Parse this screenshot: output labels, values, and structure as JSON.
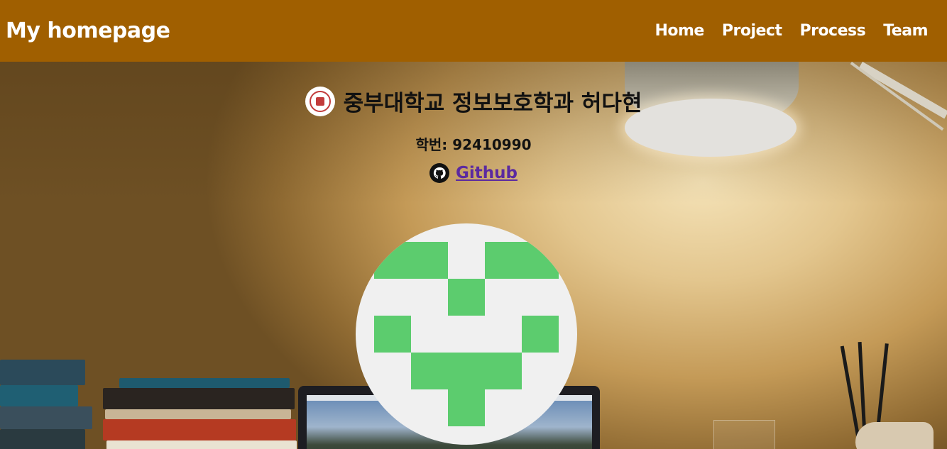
{
  "nav": {
    "brand": "My homepage",
    "links": [
      "Home",
      "Project",
      "Process",
      "Team"
    ]
  },
  "profile": {
    "title": "중부대학교 정보보호학과 허다현",
    "student_id": "학번: 92410990",
    "github_label": "Github"
  },
  "colors": {
    "navbar": "#a05f00",
    "identicon": "#5ccc6e",
    "identicon_bg": "#f0f0f0",
    "link": "#5b2aa0"
  },
  "icons": [
    "university-logo-icon",
    "github-icon"
  ]
}
